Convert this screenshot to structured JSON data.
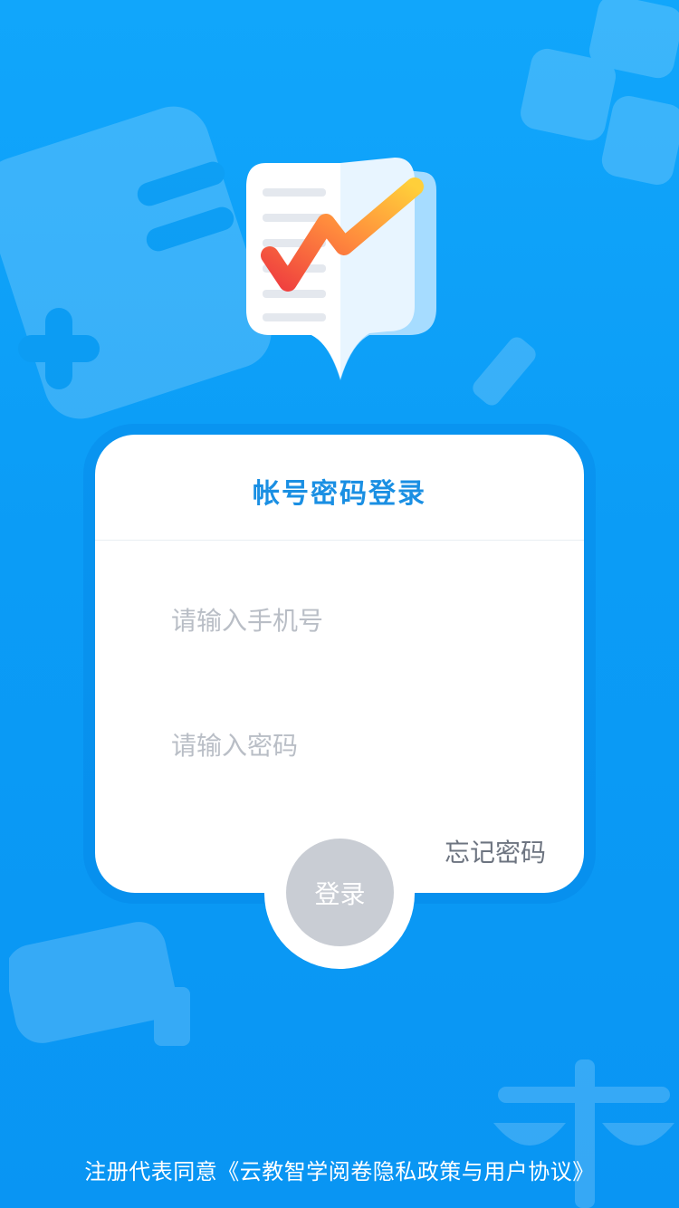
{
  "card": {
    "title": "帐号密码登录",
    "phone_placeholder": "请输入手机号",
    "password_placeholder": "请输入密码",
    "forgot_label": "忘记密码",
    "login_label": "登录"
  },
  "footer": {
    "agreement_text": "注册代表同意《云教智学阅卷隐私政策与用户协议》"
  },
  "colors": {
    "background": "#11a6fb",
    "accent": "#1a8fe3",
    "button_disabled": "#c9cdd4"
  },
  "icons": {
    "logo": "check-chart-logo-icon",
    "bg_abc": "abc-blocks-icon",
    "bg_math": "math-symbols-icon",
    "bg_pencil": "pencil-icon",
    "bg_scale": "balance-scale-icon",
    "bg_flask": "flask-icon"
  }
}
